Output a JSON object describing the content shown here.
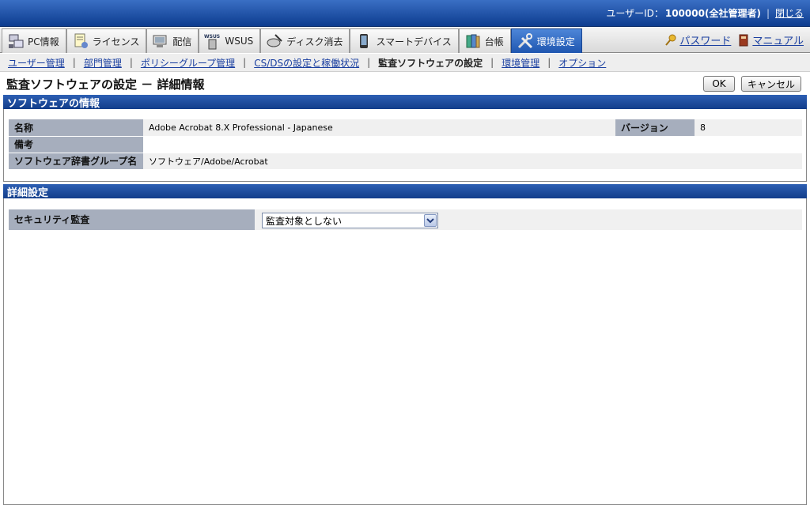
{
  "header": {
    "user_id_label": "ユーザーID：",
    "user_id_value": "100000(全社管理者)",
    "separator": "|",
    "close_label": "閉じる"
  },
  "tabs": [
    {
      "label": "PC情報",
      "icon": "pc-icon"
    },
    {
      "label": "ライセンス",
      "icon": "license-icon"
    },
    {
      "label": "配信",
      "icon": "distribution-icon"
    },
    {
      "label": "WSUS",
      "icon": "wsus-icon"
    },
    {
      "label": "ディスク消去",
      "icon": "disk-erase-icon"
    },
    {
      "label": "スマートデバイス",
      "icon": "smart-device-icon"
    },
    {
      "label": "台帳",
      "icon": "ledger-icon"
    },
    {
      "label": "環境設定",
      "icon": "settings-tools-icon",
      "active": true
    }
  ],
  "tab_links": {
    "password": "パスワード",
    "manual": "マニュアル"
  },
  "subnav": {
    "items": [
      "ユーザー管理",
      "部門管理",
      "ポリシーグループ管理",
      "CS/DSの設定と稼働状況",
      "監査ソフトウェアの設定",
      "環境管理",
      "オプション"
    ],
    "current_index": 4
  },
  "page": {
    "title": "監査ソフトウェアの設定 － 詳細情報",
    "ok_label": "OK",
    "cancel_label": "キャンセル"
  },
  "software_info": {
    "section_title": "ソフトウェアの情報",
    "name_label": "名称",
    "name_value": "Adobe Acrobat 8.X Professional - Japanese",
    "version_label": "バージョン",
    "version_value": "8",
    "remarks_label": "備考",
    "remarks_value": "",
    "dict_group_label": "ソフトウェア辞書グループ名",
    "dict_group_value": "ソフトウェア/Adobe/Acrobat"
  },
  "detail_settings": {
    "section_title": "詳細設定",
    "security_audit_label": "セキュリティ監査",
    "security_audit_value": "監査対象としない"
  },
  "colors": {
    "header_blue": "#0d3c8f",
    "active_tab": "#1f56b0",
    "link": "#1a3fa0",
    "label_bg": "#a6aebd"
  }
}
